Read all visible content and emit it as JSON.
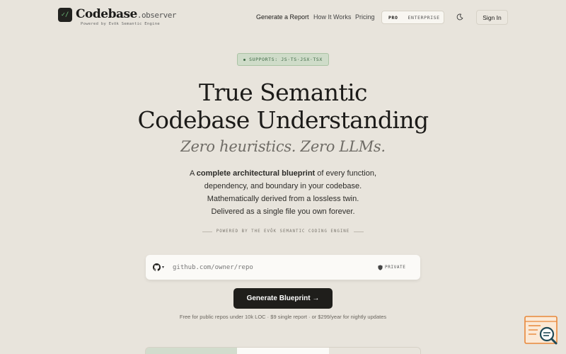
{
  "brand": {
    "name": "Codebase",
    "suffix": ".observer",
    "tagline": "Powered by Evōk Semantic Engine",
    "mark_glyph": "✓/"
  },
  "nav": {
    "links": [
      "Generate a Report",
      "How It Works",
      "Pricing"
    ],
    "plan_options": [
      "PRO",
      "ENTERPRISE"
    ],
    "active_plan": "PRO",
    "sign_in": "Sign In"
  },
  "hero": {
    "badge": "SUPPORTS: JS·TS·JSX·TSX",
    "title_line1": "True Semantic",
    "title_line2": "Codebase Understanding",
    "subtitle": "Zero heuristics. Zero LLMs.",
    "desc_prefix": "A ",
    "desc_bold": "complete architectural blueprint",
    "desc_line1_rest": " of every function,",
    "desc_line2": "dependency, and boundary in your codebase.",
    "desc_line3": "Mathematically derived from a lossless twin.",
    "desc_line4": "Delivered as a single file you own forever.",
    "powered_by": "POWERED BY THE EVŌK SEMANTIC CODING ENGINE"
  },
  "repo": {
    "placeholder": "github.com/owner/repo",
    "value": "",
    "visibility": "PRIVATE"
  },
  "cta": {
    "label": "Generate Blueprint →",
    "pricing_note": "Free for public repos under 10k LOC · $9 single report · or $299/year for nightly updates"
  },
  "colors": {
    "background": "#e8e4dc",
    "accent_green": "#3f6a46",
    "button_dark": "#1f1e1b",
    "widget_orange": "#e8883a"
  },
  "icons": [
    "github-icon",
    "shield-icon",
    "moon-icon",
    "search-widget-icon"
  ]
}
